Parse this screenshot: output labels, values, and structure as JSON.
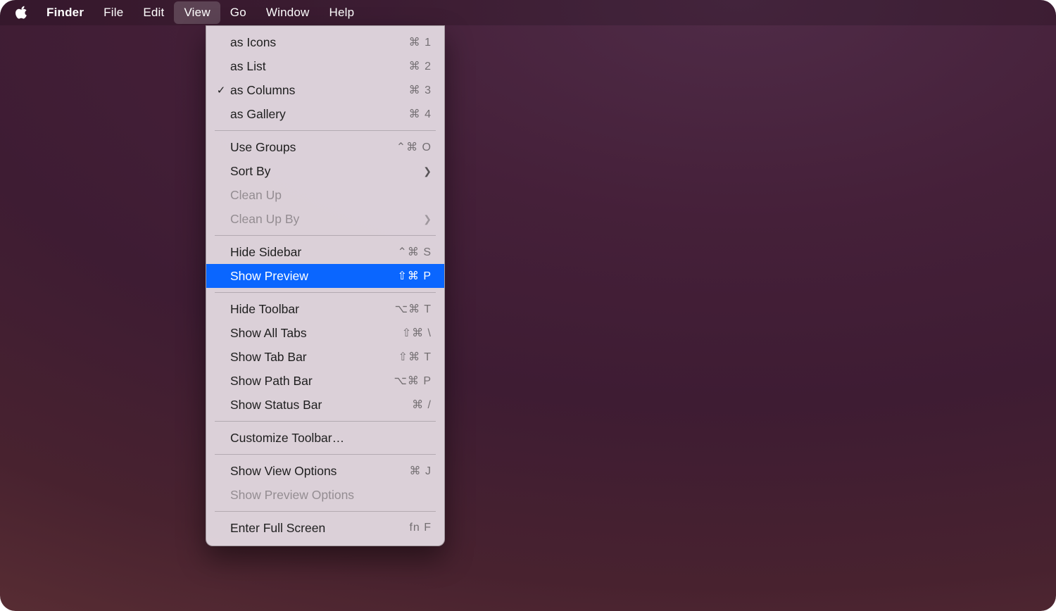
{
  "menubar": {
    "app": "Finder",
    "items": [
      "File",
      "Edit",
      "View",
      "Go",
      "Window",
      "Help"
    ],
    "openIndex": 2
  },
  "dropdown": {
    "sections": [
      [
        {
          "label": "as Icons",
          "shortcut": "⌘ 1",
          "checked": false,
          "disabled": false
        },
        {
          "label": "as List",
          "shortcut": "⌘ 2",
          "checked": false,
          "disabled": false
        },
        {
          "label": "as Columns",
          "shortcut": "⌘ 3",
          "checked": true,
          "disabled": false
        },
        {
          "label": "as Gallery",
          "shortcut": "⌘ 4",
          "checked": false,
          "disabled": false
        }
      ],
      [
        {
          "label": "Use Groups",
          "shortcut": "⌃⌘ O",
          "checked": false,
          "disabled": false
        },
        {
          "label": "Sort By",
          "shortcut": "",
          "submenu": true,
          "disabled": false
        },
        {
          "label": "Clean Up",
          "shortcut": "",
          "disabled": true
        },
        {
          "label": "Clean Up By",
          "shortcut": "",
          "submenu": true,
          "disabled": true
        }
      ],
      [
        {
          "label": "Hide Sidebar",
          "shortcut": "⌃⌘ S",
          "disabled": false
        },
        {
          "label": "Show Preview",
          "shortcut": "⇧⌘ P",
          "disabled": false,
          "highlight": true
        }
      ],
      [
        {
          "label": "Hide Toolbar",
          "shortcut": "⌥⌘ T",
          "disabled": false
        },
        {
          "label": "Show All Tabs",
          "shortcut": "⇧⌘ \\",
          "disabled": false
        },
        {
          "label": "Show Tab Bar",
          "shortcut": "⇧⌘ T",
          "disabled": false
        },
        {
          "label": "Show Path Bar",
          "shortcut": "⌥⌘ P",
          "disabled": false
        },
        {
          "label": "Show Status Bar",
          "shortcut": "⌘ /",
          "disabled": false
        }
      ],
      [
        {
          "label": "Customize Toolbar…",
          "shortcut": "",
          "disabled": false
        }
      ],
      [
        {
          "label": "Show View Options",
          "shortcut": "⌘ J",
          "disabled": false
        },
        {
          "label": "Show Preview Options",
          "shortcut": "",
          "disabled": true
        }
      ],
      [
        {
          "label": "Enter Full Screen",
          "shortcut": "fn F",
          "disabled": false
        }
      ]
    ]
  }
}
